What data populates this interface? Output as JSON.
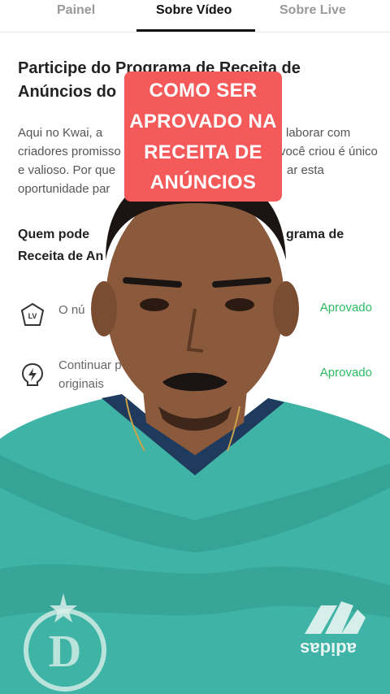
{
  "tabs": [
    {
      "label": "Painel"
    },
    {
      "label": "Sobre Vídeo"
    },
    {
      "label": "Sobre Live"
    }
  ],
  "heading": "Participe do Programa de Receita de Anúncios do",
  "intro": "Aqui no Kwai, a... criadores promisso... e valioso. Por que... oportunidade par...",
  "intro_lines": [
    "Aqui no Kwai, a",
    "criadores promisso",
    "e valioso. Por que",
    "oportunidade par"
  ],
  "intro_right": [
    "laborar com",
    "você criou é único",
    "ar esta"
  ],
  "who": {
    "left1": "Quem pode",
    "right1": "grama de",
    "left2": "Receita de An"
  },
  "requirements": [
    {
      "icon": "level-badge-icon",
      "text": "O nú",
      "status": "Aprovado"
    },
    {
      "icon": "lightning-bulb-icon",
      "text": "Continuar p",
      "text2": "originais",
      "status": "Aprovado"
    }
  ],
  "caption_lines": [
    "COMO SER",
    "APROVADO NA",
    "RECEITA DE",
    "ANÚNCIOS"
  ],
  "colors": {
    "accent_green": "#2dbb63",
    "caption_bg": "#f45a5a",
    "tab_active": "#111111",
    "shirt": "#3fb3a5"
  }
}
